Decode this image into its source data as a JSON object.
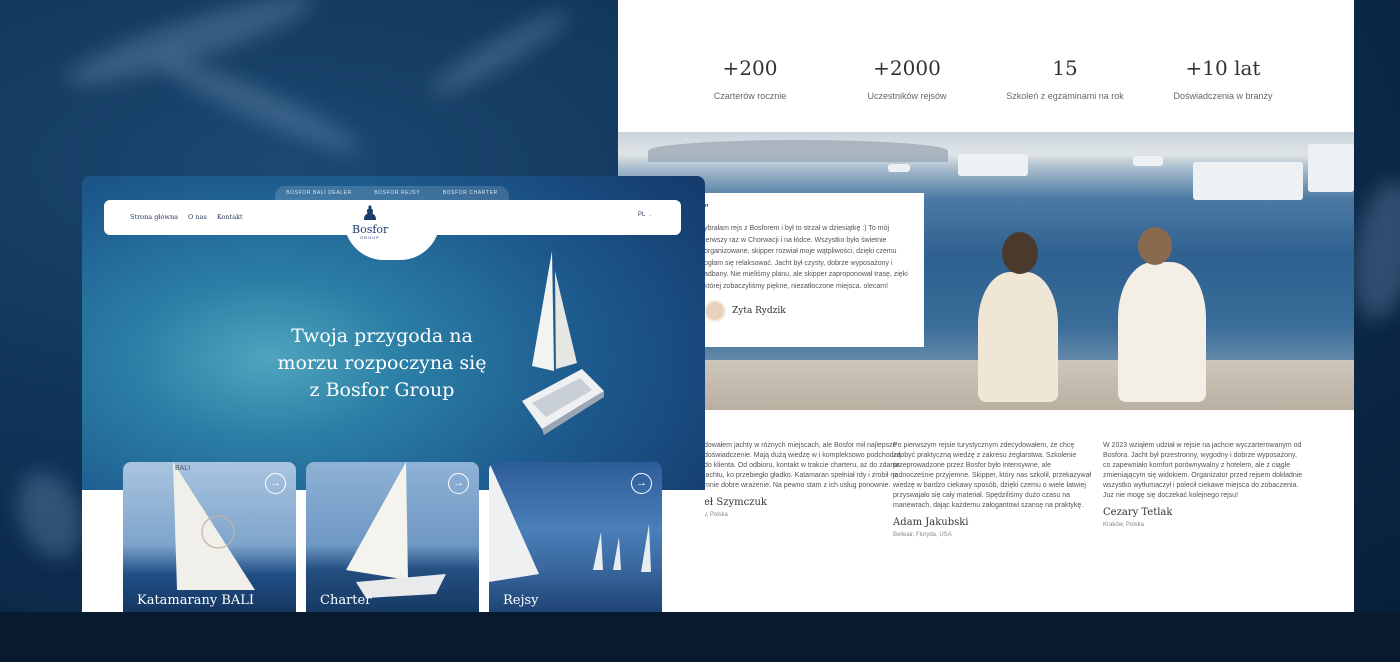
{
  "stats": [
    {
      "value": "+200",
      "label": "Czarterów rocznie"
    },
    {
      "value": "+2000",
      "label": "Uczestników rejsów"
    },
    {
      "value": "15",
      "label": "Szkoleń z egzaminami na rok"
    },
    {
      "value": "+10 lat",
      "label": "Doświadczenia w branży"
    }
  ],
  "featured_testimonial": {
    "quote_mark": "”",
    "text": "ybrałam rejs z Bosforem i był to strzał w dziesiątkę :) To mój ierwszy raz w Chorwacji i na łódce. Wszystko było świetnie organizowane, skipper rozwiał moje wątpliwości, dzięki czemu ogłam się relaksować. Jacht był czysty, dobrze wyposażony i adbany. Nie mieliśmy planu, ale skipper zaproponował trasę, zięki której zobaczyliśmy piękne, niezatłoczone miejsca. olecam!",
    "name": "Zyta Rydzik"
  },
  "reviews": [
    {
      "text": "dowałem jachty w różnych miejscach, ale Bosfor mił najlepsze doświadczenie. Mają dużą wiedzę w i kompleksowo podchodzą do klienta. Od odbioru, kontakt w trakcie charteru, aż do zdania jachtu, ko przebiegło gładko. Katamaran spełniał rdy i zrobił na mnie dobre wrażenie. Na pewno stam z ich usług ponownie.",
      "name": "eł Szymczuk",
      "location": "v, Polska"
    },
    {
      "text": "Po pierwszym rejsie turystycznym zdecydowałem, że chcę zdobyć praktyczną wiedzę z zakresu żeglarstwa. Szkolenie przeprowadzone przez Bosfor było intensywne, ale jednocześnie przyjemne. Skipper, który nas szkolił, przekazywał wiedzę w bardzo ciekawy sposób, dzięki czemu o wiele łatwiej przyswajało się cały materiał. Spędziliśmy dużo czasu na manewrach, dając każdemu załogantowi szansę na praktykę.",
      "name": "Adam Jakubski",
      "location": "Belleair, Floryda, USA"
    },
    {
      "text": "W 2023 wziąłem udział w rejsie na jachcie wyczarterowanym od Bosfora. Jacht był przestronny, wygodny i dobrze wyposażony, co zapewniało komfort porównywalny z hotelem, ale z ciągle zmieniającym się widokiem. Organizator przed rejsem dokładnie wszystko wytłumaczył i polecił ciekawe miejsca do zobaczenia. Już nie mogę się doczekać kolejnego rejsu!",
      "name": "Cezary Tetlak",
      "location": "Kraków, Polska"
    }
  ],
  "subnav": [
    "BOSFOR BALI DEALER",
    "BOSFOR REJSY",
    "BOSFOR CHARTER"
  ],
  "nav": {
    "links": [
      "Strona główna",
      "O nas",
      "Kontakt"
    ],
    "lang": "PL",
    "lang_icon": "⌄"
  },
  "logo": {
    "mark": "♟",
    "brand": "Bosfor",
    "sub": "GROUP"
  },
  "hero": {
    "line1": "Twoja przygoda na",
    "line2": "morzu rozpoczyna się",
    "line3": "z Bosfor Group"
  },
  "cards": [
    {
      "title": "Katamarany BALI",
      "arrow": "→",
      "sail_text": "BALI"
    },
    {
      "title": "Charter",
      "arrow": "→"
    },
    {
      "title": "Rejsy",
      "arrow": "→"
    }
  ],
  "colors": {
    "navy": "#1c3d6b",
    "ocean": "#2b7fa6",
    "background": "#0f3257"
  }
}
